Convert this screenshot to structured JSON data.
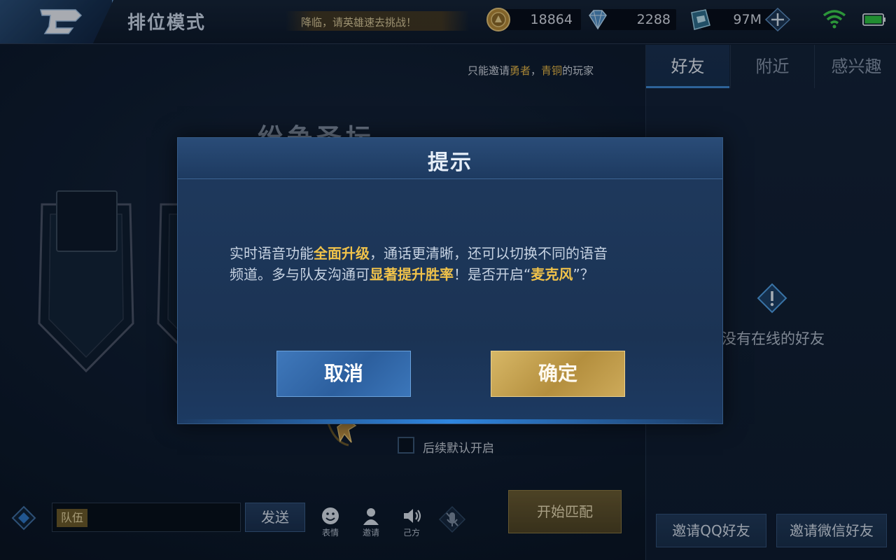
{
  "topbar": {
    "title": "排位模式",
    "marquee": "降临，请英雄速去挑战！",
    "gold": "18864",
    "diamond": "2288",
    "ticket": "97M"
  },
  "lobby": {
    "invite_note_prefix": "只能邀请",
    "invite_rank_1": "勇者",
    "invite_sep": "，",
    "invite_rank_2": "青铜",
    "invite_note_suffix": "的玩家",
    "stage_title": "纷争圣坛",
    "checkbox_label": "后续默认开启",
    "checkbox_checked": false
  },
  "chat": {
    "channel": "队伍",
    "send": "发送",
    "quick": [
      "表情",
      "邀请",
      "己方"
    ],
    "start_match": "开始匹配"
  },
  "friends": {
    "tabs": [
      "好友",
      "附近",
      "感兴趣"
    ],
    "active_tab": 0,
    "empty_text": "没有在线的好友",
    "invite_qq": "邀请QQ好友",
    "invite_wechat": "邀请微信好友"
  },
  "dialog": {
    "title": "提示",
    "line1_a": "实时语音功能",
    "line1_hl": "全面升级",
    "line1_b": "，通话更清晰，还可以切换不同的语音",
    "line2_a": "频道。多与队友沟通可",
    "line2_hl": "显著提升胜率",
    "line2_b": "！是否开启“",
    "line2_hl2": "麦克风",
    "line2_c": "”？",
    "cancel": "取消",
    "confirm": "确定"
  },
  "colors": {
    "highlight_gold": "#f0c24a",
    "cancel_blue": "#3f78bb",
    "confirm_gold": "#c9a453"
  }
}
